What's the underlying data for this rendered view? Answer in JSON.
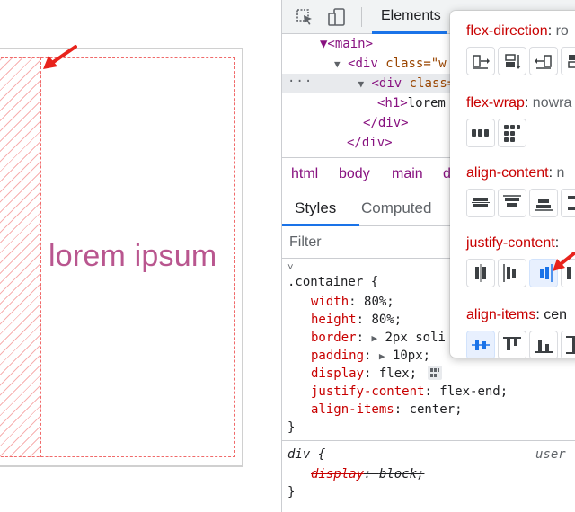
{
  "preview": {
    "text": "lorem ipsum"
  },
  "devtools": {
    "tab_elements": "Elements",
    "dom": {
      "line1": {
        "tag_open": "▼<main>"
      },
      "line2": {
        "tag": "<div",
        "attr": "class=\"w"
      },
      "line3": {
        "tag": "<div",
        "attr": "class="
      },
      "line4": {
        "tag_open": "<h1>",
        "text": "lorem"
      },
      "line5": {
        "tag": "</div>"
      },
      "line6": {
        "tag": "</div>"
      },
      "dots": "···"
    },
    "breadcrumbs": [
      "html",
      "body",
      "main",
      "d"
    ],
    "subtabs": [
      "Styles",
      "Computed"
    ],
    "filter_placeholder": "Filter",
    "css_rule": {
      "selector": ".container {",
      "decls": [
        {
          "prop": "width",
          "val": "80%;"
        },
        {
          "prop": "height",
          "val": "80%;"
        },
        {
          "prop": "border",
          "val": "2px soli"
        },
        {
          "prop": "padding",
          "val": "10px;"
        },
        {
          "prop": "display",
          "val": "flex;"
        },
        {
          "prop": "justify-content",
          "val": "flex-end;"
        },
        {
          "prop": "align-items",
          "val": "center;"
        }
      ],
      "close": "}"
    },
    "ua_rule": {
      "selector": "div {",
      "source": "user",
      "prop": "display",
      "val": "block;",
      "close": "}"
    }
  },
  "flex_editor": {
    "flex_direction": {
      "name": "flex-direction",
      "value": "ro"
    },
    "flex_wrap": {
      "name": "flex-wrap",
      "value": "nowra"
    },
    "align_content": {
      "name": "align-content",
      "value": "n"
    },
    "justify_content": {
      "name": "justify-content",
      "value": ""
    },
    "align_items": {
      "name": "align-items",
      "value": "cen"
    }
  },
  "colors": {
    "accent": "#1a73e8",
    "property": "#c80000",
    "tag": "#881280",
    "lorem": "#b9568f",
    "annotation_arrow": "#e8231c"
  }
}
